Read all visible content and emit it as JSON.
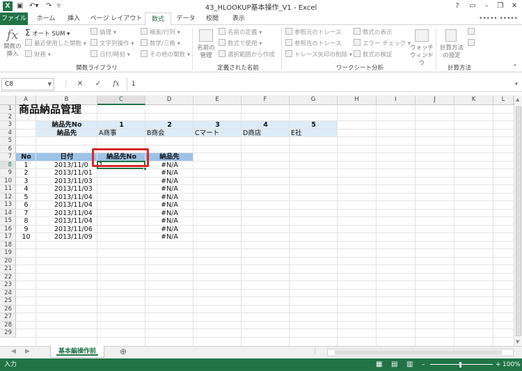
{
  "app": {
    "window_title": "43_HLOOKUP基本操作_V1 - Excel",
    "user_name": "••••• •••••",
    "help_label": "?",
    "minimize_label": "–",
    "restore_label": "❐",
    "close_label": "✕"
  },
  "ribbon": {
    "tabs": [
      {
        "label": "ファイル"
      },
      {
        "label": "ホーム"
      },
      {
        "label": "挿入"
      },
      {
        "label": "ページ レイアウト"
      },
      {
        "label": "数式"
      },
      {
        "label": "データ"
      },
      {
        "label": "校閲"
      },
      {
        "label": "表示"
      }
    ],
    "active_tab": "数式",
    "function_library": {
      "insert_function": "関数の\n挿入",
      "autosum": "オート SUM",
      "recent": "最近使用した関数",
      "financial": "財務",
      "logical": "論理",
      "text": "文字列操作",
      "datetime": "日付/時刻",
      "lookup": "検索/行列",
      "math": "数学/三角",
      "other": "その他の関数",
      "group_label": "関数ライブラリ"
    },
    "defined_names": {
      "name_manager": "名前の\n管理",
      "define_name": "名前の定義",
      "use_in_formula": "数式で使用",
      "create_from_selection": "選択範囲から作成",
      "group_label": "定義された名前"
    },
    "formula_auditing": {
      "trace_precedents": "参照元のトレース",
      "trace_dependents": "参照先のトレース",
      "remove_arrows": "トレース矢印の削除",
      "show_formulas": "数式の表示",
      "error_checking": "エラー チェック",
      "evaluate_formula": "数式の検証",
      "watch_window": "ウォッチ\nウィンドウ",
      "group_label": "ワークシート分析"
    },
    "calculation": {
      "calc_options": "計算方法\nの設定",
      "group_label": "計算方法"
    }
  },
  "formula_bar": {
    "name_box": "C8",
    "cancel_icon": "✕",
    "enter_icon": "✓",
    "fx_label": "fx",
    "content": "1"
  },
  "sheet": {
    "columns": [
      "A",
      "B",
      "C",
      "D",
      "E",
      "F",
      "G",
      "H",
      "I",
      "J",
      "K",
      "L"
    ],
    "selected_column": "C",
    "row_numbers": [
      "1",
      "2",
      "3",
      "4",
      "5",
      "6",
      "7",
      "8",
      "9",
      "10",
      "11",
      "12",
      "13",
      "14",
      "15",
      "16",
      "17",
      "18",
      "19",
      "20",
      "21",
      "22",
      "23",
      "24",
      "25",
      "26",
      "27",
      "28",
      "29"
    ],
    "selected_row": "8",
    "title": "商品納品管理",
    "lookup_table": {
      "row_label_no": "納品先No",
      "row_label_name": "納品先",
      "numbers": [
        "1",
        "2",
        "3",
        "4",
        "5"
      ],
      "names": [
        "A商事",
        "B商会",
        "Cマート",
        "D商店",
        "E社"
      ]
    },
    "table_headers": {
      "no": "No",
      "date": "日付",
      "dest_no": "納品先No",
      "dest": "納品先"
    },
    "rows": [
      {
        "no": "1",
        "date": "2013/11/0",
        "dest_no": "1",
        "dest": "#N/A"
      },
      {
        "no": "2",
        "date": "2013/11/01",
        "dest_no": "",
        "dest": "#N/A"
      },
      {
        "no": "3",
        "date": "2013/11/03",
        "dest_no": "",
        "dest": "#N/A"
      },
      {
        "no": "4",
        "date": "2013/11/03",
        "dest_no": "",
        "dest": "#N/A"
      },
      {
        "no": "5",
        "date": "2013/11/04",
        "dest_no": "",
        "dest": "#N/A"
      },
      {
        "no": "6",
        "date": "2013/11/04",
        "dest_no": "",
        "dest": "#N/A"
      },
      {
        "no": "7",
        "date": "2013/11/04",
        "dest_no": "",
        "dest": "#N/A"
      },
      {
        "no": "8",
        "date": "2013/11/04",
        "dest_no": "",
        "dest": "#N/A"
      },
      {
        "no": "9",
        "date": "2013/11/06",
        "dest_no": "",
        "dest": "#N/A"
      },
      {
        "no": "10",
        "date": "2013/11/09",
        "dest_no": "",
        "dest": "#N/A"
      }
    ]
  },
  "sheet_tabs": {
    "active": "基本編操作前",
    "add_label": "⊕"
  },
  "status": {
    "mode": "入力",
    "zoom": "100%"
  },
  "colors": {
    "accent": "#217346",
    "header_fill": "#9dc3e6",
    "lookup_fill": "#ddebf7",
    "highlight": "#d9262c"
  }
}
